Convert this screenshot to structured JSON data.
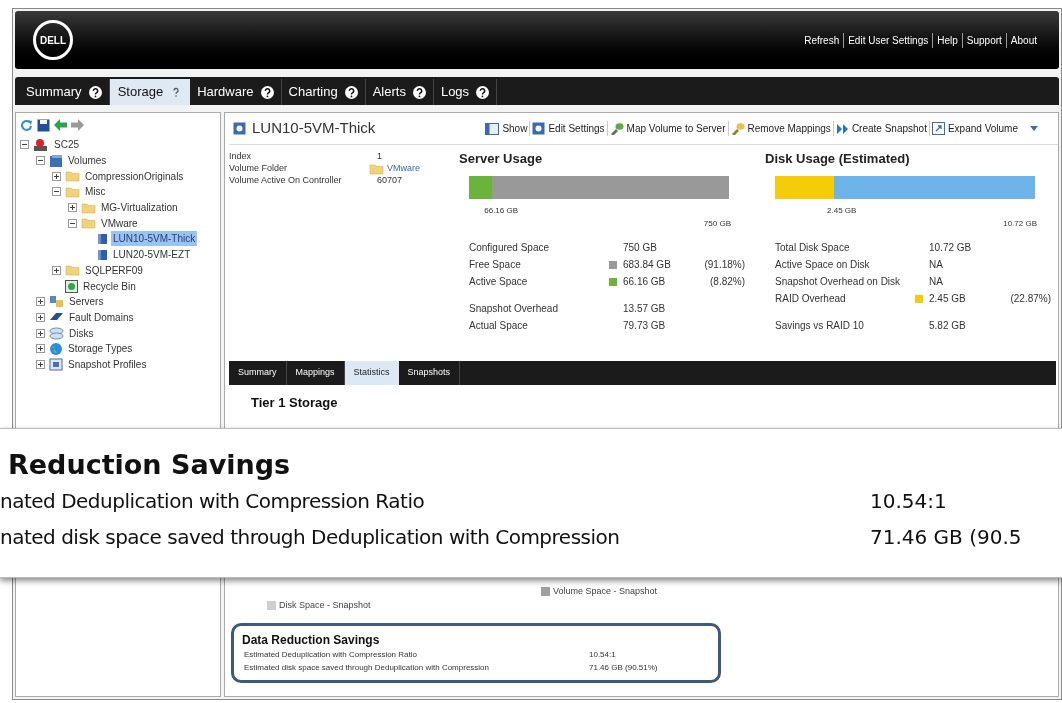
{
  "header": {
    "logo": "DELL",
    "links": [
      "Refresh",
      "Edit User Settings",
      "Help",
      "Support",
      "About"
    ]
  },
  "tabs": [
    {
      "label": "Summary",
      "selected": false
    },
    {
      "label": "Storage",
      "selected": true
    },
    {
      "label": "Hardware",
      "selected": false
    },
    {
      "label": "Charting",
      "selected": false
    },
    {
      "label": "Alerts",
      "selected": false
    },
    {
      "label": "Logs",
      "selected": false
    }
  ],
  "tree": [
    {
      "label": "SC25",
      "kind": "system",
      "expanded": true,
      "selected": false,
      "children": [
        {
          "label": "Volumes",
          "kind": "volumes",
          "expanded": true,
          "selected": false,
          "children": [
            {
              "label": "CompressionOriginals",
              "kind": "folder",
              "expanded": false,
              "selected": false
            },
            {
              "label": "Misc",
              "kind": "folder",
              "expanded": true,
              "selected": false,
              "children": [
                {
                  "label": "MG-Virtualization",
                  "kind": "folder",
                  "expanded": false,
                  "selected": false
                },
                {
                  "label": "VMware",
                  "kind": "folder",
                  "expanded": true,
                  "selected": false,
                  "children": [
                    {
                      "label": "LUN10-5VM-Thick",
                      "kind": "volume",
                      "selected": true
                    },
                    {
                      "label": "LUN20-5VM-EZT",
                      "kind": "volume",
                      "selected": false
                    }
                  ]
                }
              ]
            },
            {
              "label": "SQLPERF09",
              "kind": "folder",
              "expanded": false,
              "selected": false
            },
            {
              "label": "Recycle Bin",
              "kind": "recycle",
              "selected": false
            }
          ]
        },
        {
          "label": "Servers",
          "kind": "servers",
          "expanded": false,
          "selected": false
        },
        {
          "label": "Fault Domains",
          "kind": "fault",
          "expanded": false,
          "selected": false
        },
        {
          "label": "Disks",
          "kind": "disks",
          "expanded": false,
          "selected": false
        },
        {
          "label": "Storage Types",
          "kind": "globe",
          "expanded": false,
          "selected": false
        },
        {
          "label": "Snapshot Profiles",
          "kind": "profiles",
          "expanded": false,
          "selected": false
        }
      ]
    }
  ],
  "volume": {
    "title": "LUN10-5VM-Thick",
    "actions": [
      {
        "label": "Show",
        "kind": "show"
      },
      {
        "label": "Edit Settings",
        "kind": "settings"
      },
      {
        "label": "Map Volume to Server",
        "kind": "map"
      },
      {
        "label": "Remove Mappings",
        "kind": "remove"
      },
      {
        "label": "Create Snapshot",
        "kind": "snapshot"
      },
      {
        "label": "Expand Volume",
        "kind": "expand"
      }
    ],
    "properties": [
      {
        "label": "Index",
        "value": "1",
        "kind": "text"
      },
      {
        "label": "Volume Folder",
        "value": "VMware",
        "kind": "folder"
      },
      {
        "label": "Volume Active On Controller",
        "value": "60707",
        "kind": "text"
      }
    ]
  },
  "server_usage": {
    "title": "Server Usage",
    "level": 0.0882,
    "bar_label": "66.16 GB",
    "bar_max": "750 GB",
    "groups": [
      [
        {
          "label": "Configured Space",
          "value": "750 GB"
        },
        {
          "label": "Free Space",
          "value": "683.84 GB",
          "percent": "(91.18%)",
          "color": "#999999"
        },
        {
          "label": "Active Space",
          "value": "66.16 GB",
          "percent": "(8.82%)",
          "color": "#6ab43e"
        }
      ],
      [
        {
          "label": "Snapshot Overhead",
          "value": "13.57 GB"
        },
        {
          "label": "Actual Space",
          "value": "79.73 GB"
        }
      ]
    ]
  },
  "disk_usage": {
    "title": "Disk Usage (Estimated)",
    "level": 0.2287,
    "bar_label": "2.45 GB",
    "bar_max": "10.72 GB",
    "groups": [
      [
        {
          "label": "Total Disk Space",
          "value": "10.72 GB"
        },
        {
          "label": "Active Space on Disk",
          "value": "NA"
        },
        {
          "label": "Snapshot Overhead on Disk",
          "value": "NA"
        },
        {
          "label": "RAID Overhead",
          "value": "2.45 GB",
          "percent": "(22.87%)",
          "color": "#f5cc0a"
        }
      ],
      [
        {
          "label": "Savings vs RAID 10",
          "value": "5.82 GB"
        }
      ]
    ]
  },
  "sub_tabs": [
    {
      "label": "Summary",
      "selected": false
    },
    {
      "label": "Mappings",
      "selected": false
    },
    {
      "label": "Statistics",
      "selected": true
    },
    {
      "label": "Snapshots",
      "selected": false
    }
  ],
  "tier_title": "Tier 1 Storage",
  "callout": {
    "title": "Reduction Savings",
    "rows": [
      {
        "label": "nated Deduplication with Compression Ratio",
        "value": "10.54:1"
      },
      {
        "label": "nated disk space saved through Deduplication with Compression",
        "value": "71.46 GB (90.5"
      }
    ]
  },
  "legend": [
    {
      "label": "Volume Space - Snapshot",
      "color": "#a0a0a0"
    },
    {
      "label": "Disk Space - Snapshot",
      "color": "#cfcfcf"
    }
  ],
  "data_reduction": {
    "title": "Data Reduction Savings",
    "rows": [
      {
        "label": "Estimated Deduplication with Compression Ratio",
        "value": "10.54:1"
      },
      {
        "label": "Estimated disk space saved through Deduplication with Compression",
        "value": "71.46 GB (90.51%)"
      }
    ]
  }
}
